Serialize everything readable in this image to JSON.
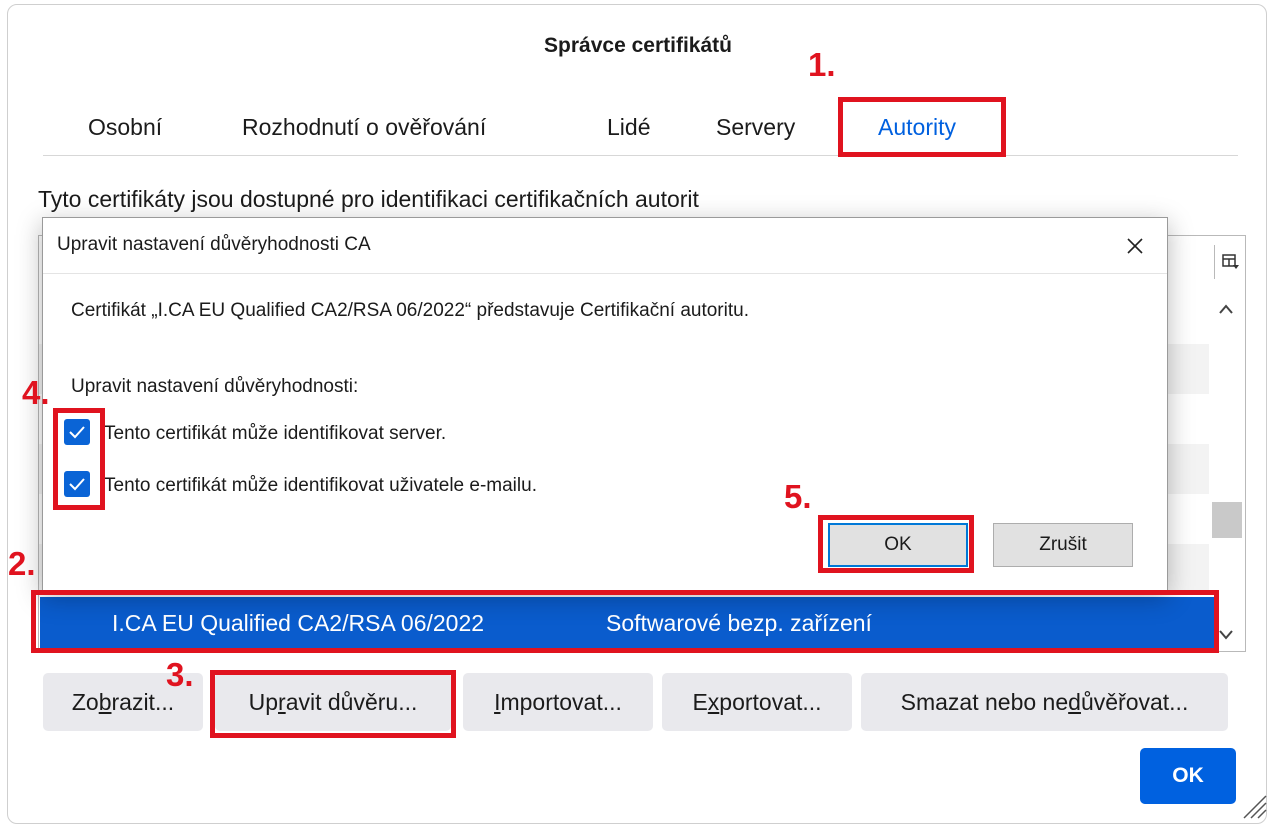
{
  "window": {
    "title": "Správce certifikátů"
  },
  "tabs": [
    {
      "label": "Osobní"
    },
    {
      "label": "Rozhodnutí o ověřování"
    },
    {
      "label": "Lidé"
    },
    {
      "label": "Servery"
    },
    {
      "label": "Autority",
      "active": true
    }
  ],
  "description": "Tyto certifikáty jsou dostupné pro identifikaci certifikačních autorit",
  "selected_row": {
    "name": "I.CA EU Qualified CA2/RSA 06/2022",
    "device": "Softwarové bezp. zařízení"
  },
  "buttons": {
    "view": {
      "before": "Zo",
      "underline": "b",
      "after": "razit..."
    },
    "edit": {
      "before": "Up",
      "underline": "r",
      "after": "avit důvěru..."
    },
    "import": {
      "before": "",
      "underline": "I",
      "after": "mportovat..."
    },
    "export": {
      "before": "E",
      "underline": "x",
      "after": "portovat..."
    },
    "delete": {
      "before": "Smazat nebo ne",
      "underline": "d",
      "after": "ůvěřovat..."
    },
    "ok": "OK"
  },
  "dialog": {
    "title": "Upravit nastavení důvěryhodnosti CA",
    "cert_text": "Certifikát „I.CA EU Qualified CA2/RSA 06/2022“ představuje Certifikační autoritu.",
    "trust_heading": "Upravit nastavení důvěryhodnosti:",
    "checkbox_server": {
      "label": "Tento certifikát může identifikovat server.",
      "checked": true
    },
    "checkbox_email": {
      "label": "Tento certifikát může identifikovat uživatele e-mailu.",
      "checked": true
    },
    "ok_label": "OK",
    "cancel_label": "Zrušit"
  },
  "annotations": [
    "1.",
    "2.",
    "3.",
    "4.",
    "5."
  ],
  "colors": {
    "accent": "#0061e0",
    "selection": "#0a5ccd",
    "annotation": "#e0131f"
  }
}
